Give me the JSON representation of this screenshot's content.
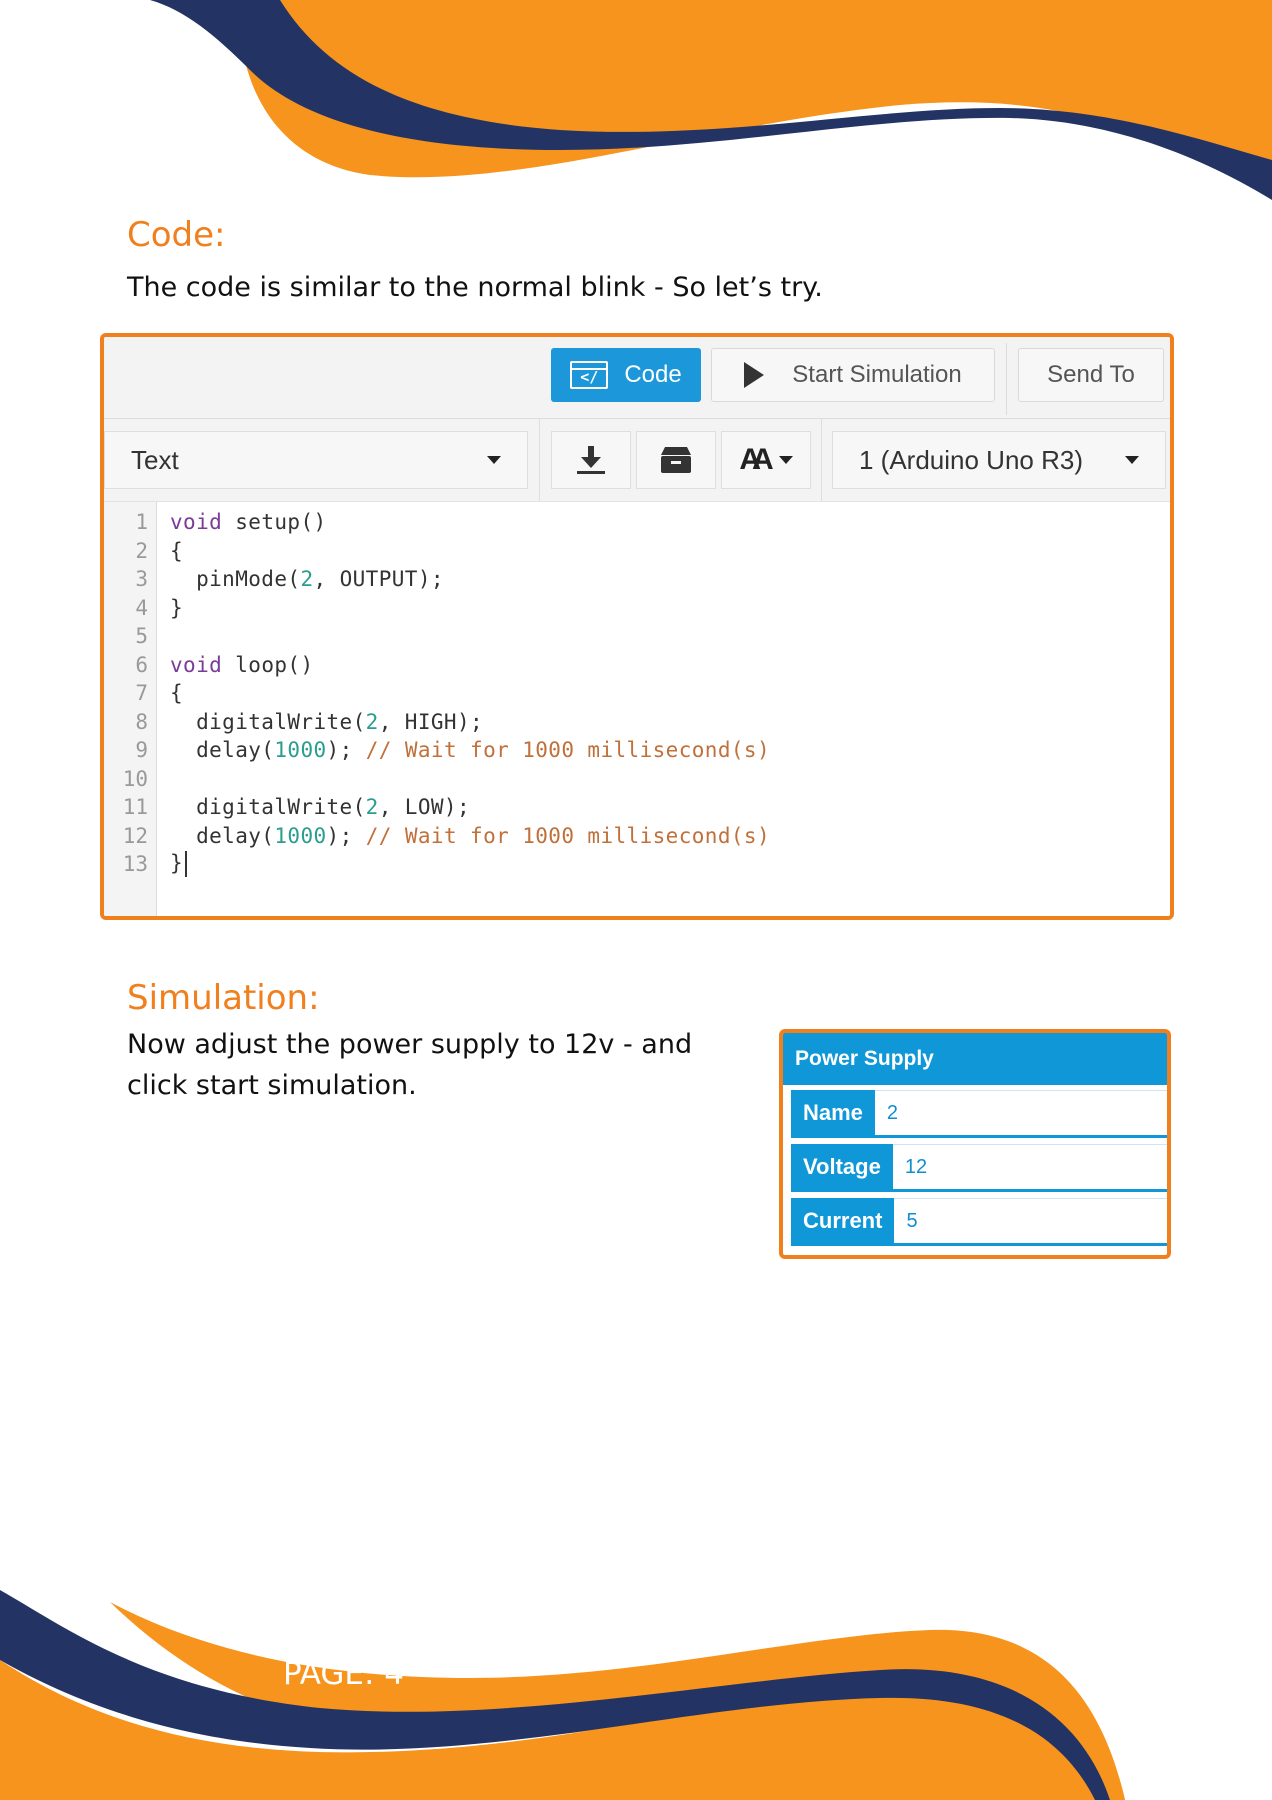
{
  "code_section": {
    "heading": "Code:",
    "description": "The code is similar to the normal blink - So let’s try."
  },
  "editor": {
    "code_button": "Code",
    "code_icon_glyph": "</",
    "start_simulation_button": "Start Simulation",
    "send_to_button": "Send To",
    "mode_select": "Text",
    "board_select": "1 (Arduino Uno R3)",
    "font_size_glyph": "AA",
    "lines": [
      {
        "n": "1",
        "text": "void setup()"
      },
      {
        "n": "2",
        "text": "{"
      },
      {
        "n": "3",
        "text": "  pinMode(2, OUTPUT);"
      },
      {
        "n": "4",
        "text": "}"
      },
      {
        "n": "5",
        "text": ""
      },
      {
        "n": "6",
        "text": "void loop()"
      },
      {
        "n": "7",
        "text": "{"
      },
      {
        "n": "8",
        "text": "  digitalWrite(2, HIGH);"
      },
      {
        "n": "9",
        "text": "  delay(1000); // Wait for 1000 millisecond(s)"
      },
      {
        "n": "10",
        "text": ""
      },
      {
        "n": "11",
        "text": "  digitalWrite(2, LOW);"
      },
      {
        "n": "12",
        "text": "  delay(1000); // Wait for 1000 millisecond(s)"
      },
      {
        "n": "13",
        "text": "}"
      }
    ]
  },
  "simulation_section": {
    "heading": "Simulation:",
    "line1": "Now adjust the power supply to 12v  - and",
    "line2": "click start simulation."
  },
  "power_supply": {
    "title": "Power Supply",
    "fields": [
      {
        "label": "Name",
        "value": "2"
      },
      {
        "label": "Voltage",
        "value": "12"
      },
      {
        "label": "Current",
        "value": "5"
      }
    ]
  },
  "footer": {
    "page_label": "PAGE: 4"
  },
  "colors": {
    "accent_orange": "#f7941d",
    "navy": "#233464",
    "heading_orange": "#f07f1e",
    "button_blue": "#1c97d9",
    "keyword": "#7a3b99",
    "number": "#2a9d8f",
    "comment": "#c0703a"
  }
}
